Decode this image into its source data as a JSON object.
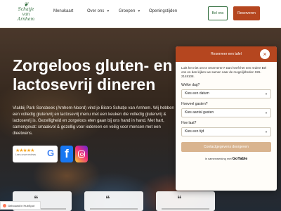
{
  "header": {
    "logo_text": "Schatje van Arnhem",
    "nav": [
      {
        "label": "Menukaart",
        "has_dropdown": false
      },
      {
        "label": "Over ons",
        "has_dropdown": true
      },
      {
        "label": "Groepen",
        "has_dropdown": true
      },
      {
        "label": "Openingstijden",
        "has_dropdown": false
      }
    ],
    "about_button": "Bel ons",
    "reserve_button": "Reserveren"
  },
  "hero": {
    "title": "Zorgeloos gluten- en lactosevrij dineren",
    "body": "Vlakbij Park Sonsbeek (Arnhem-Noord) vind je Bistro Schatje van Arnhem. Wij hebben een volledig glutenvrij en lactosevrij menu met een keuken die volledig glutenvrij & lactosevrij is. Gezelligheid en zorgeloos eten gaan bij ons hand in hand. Met hart, samengevat: smaakvol & gezellig voor iedereen en veilig voor mensen met een dieetwens."
  },
  "social": {
    "rating_stars": "★★★★★",
    "review_label": "Lees onze reviews",
    "google_letter": "G",
    "facebook_letter": "f"
  },
  "hubspot_label": "Gebouwd in HubSpot",
  "modal": {
    "title": "Reserveer een tafel",
    "close": "×",
    "intro": "Lukt het niet om te reserveren? Dan heeft het een reden! Bel ons en dan kijken we samen naar de mogelijkheden 026-2148108.",
    "q_day": "Welke dag?",
    "day_value": "Kies een datum",
    "q_guests": "Hoeveel gasten?",
    "guests_value": "Kies aantal gasten",
    "q_time": "Hoe laat?",
    "time_value": "Kies een tijd",
    "submit": "Contactgegevens doorgeven",
    "powered_prefix": "In samenwerking met",
    "powered_brand": "GoTable"
  },
  "colors": {
    "accent": "#b5461f",
    "brand_green": "#2e6b3a",
    "submit_disabled": "#d9b48f"
  }
}
